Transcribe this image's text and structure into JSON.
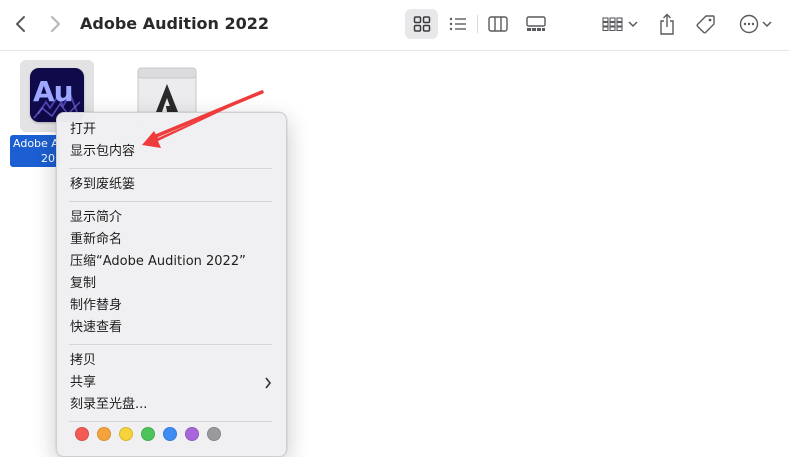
{
  "window": {
    "title": "Adobe Audition 2022"
  },
  "toolbar": {
    "back_icon": "chevron-left-icon",
    "forward_icon": "chevron-right-icon",
    "view_icons": [
      "grid-view-icon",
      "list-view-icon",
      "column-view-icon",
      "gallery-view-icon"
    ],
    "selected_view": "grid-view-icon",
    "group_icon": "group-grid-icon",
    "share_icon": "share-icon",
    "tag_icon": "tag-icon",
    "more_icon": "more-ellipsis-icon"
  },
  "files": [
    {
      "name_line1": "Adobe A",
      "name_line2": "20",
      "icon": "adobe-audition-app-icon",
      "icon_text": "Au",
      "selected": true
    },
    {
      "icon": "adobe-installer-icon"
    }
  ],
  "context_menu": {
    "group1": [
      "打开",
      "显示包内容"
    ],
    "group2": [
      "移到废纸篓"
    ],
    "group3": [
      "显示简介",
      "重新命名",
      "压缩“Adobe Audition 2022”",
      "复制",
      "制作替身",
      "快速查看"
    ],
    "group4": [
      "拷贝",
      "共享",
      "刻录至光盘..."
    ],
    "tag_colors": [
      "#f25c54",
      "#f5a33b",
      "#f6d23b",
      "#4cc45a",
      "#3d8df5",
      "#a866d8",
      "#9a9a9e"
    ]
  },
  "annotation": {
    "arrow_color": "#ef3b3b"
  }
}
